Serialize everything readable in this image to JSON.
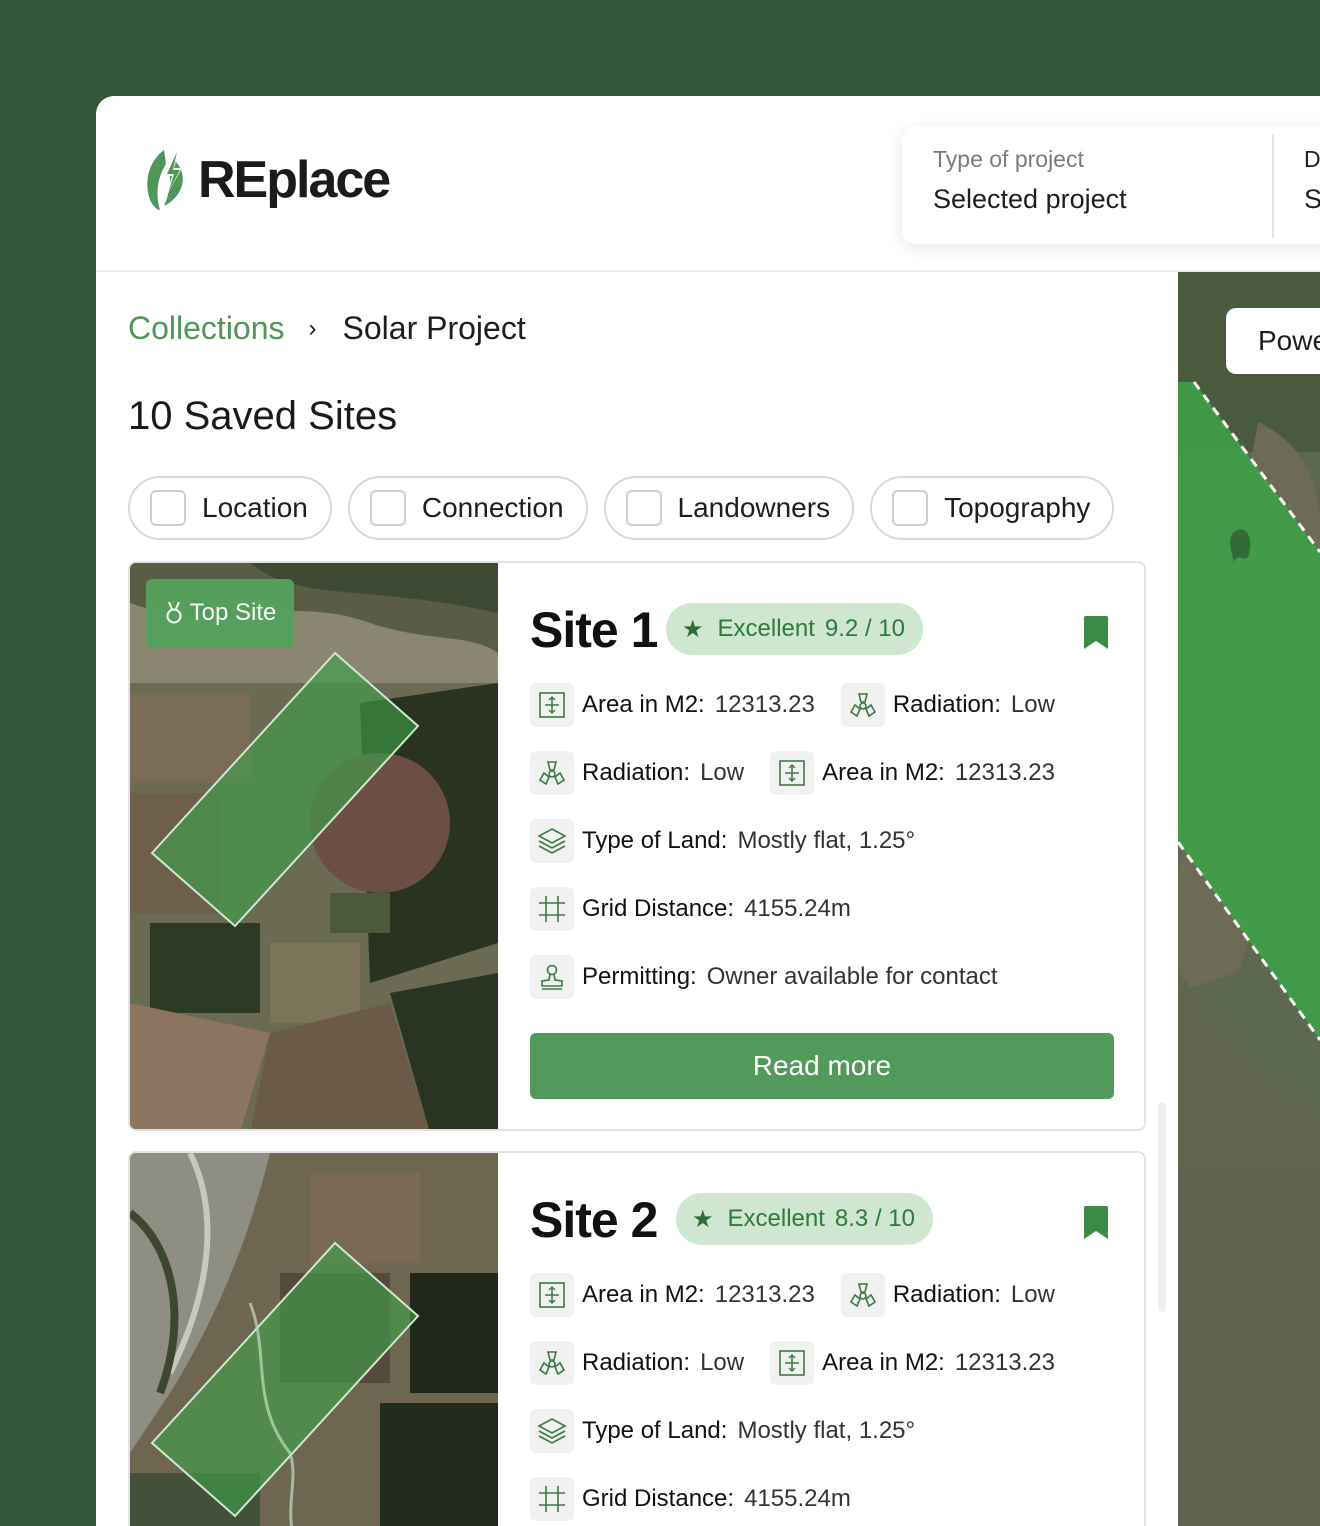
{
  "brand": {
    "name": "REplace"
  },
  "project_selector": {
    "type_label": "Type of project",
    "type_value": "Selected project",
    "second_label": "D",
    "second_value": "S"
  },
  "breadcrumb": {
    "parent": "Collections",
    "separator": "›",
    "current": "Solar Project"
  },
  "page_title": "10 Saved Sites",
  "filters": [
    "Location",
    "Connection",
    "Landowners",
    "Topography"
  ],
  "map": {
    "layer_chip": "Powe"
  },
  "sites": [
    {
      "title": "Site 1",
      "badge": "Top Site",
      "score_label": "Excellent",
      "score_value": "9.2 / 10",
      "rows": {
        "area_label": "Area in M2:",
        "area_value": "12313.23",
        "radiation_label": "Radiation:",
        "radiation_value": "Low",
        "land_label": "Type of Land:",
        "land_value": "Mostly flat, 1.25°",
        "grid_label": "Grid Distance:",
        "grid_value": "4155.24m",
        "permit_label": "Permitting:",
        "permit_value": "Owner available for contact"
      },
      "cta": "Read more"
    },
    {
      "title": "Site 2",
      "score_label": "Excellent",
      "score_value": "8.3 / 10",
      "rows": {
        "area_label": "Area in M2:",
        "area_value": "12313.23",
        "radiation_label": "Radiation:",
        "radiation_value": "Low",
        "land_label": "Type of Land:",
        "land_value": "Mostly flat, 1.25°",
        "grid_label": "Grid Distance:",
        "grid_value": "4155.24m"
      }
    }
  ]
}
